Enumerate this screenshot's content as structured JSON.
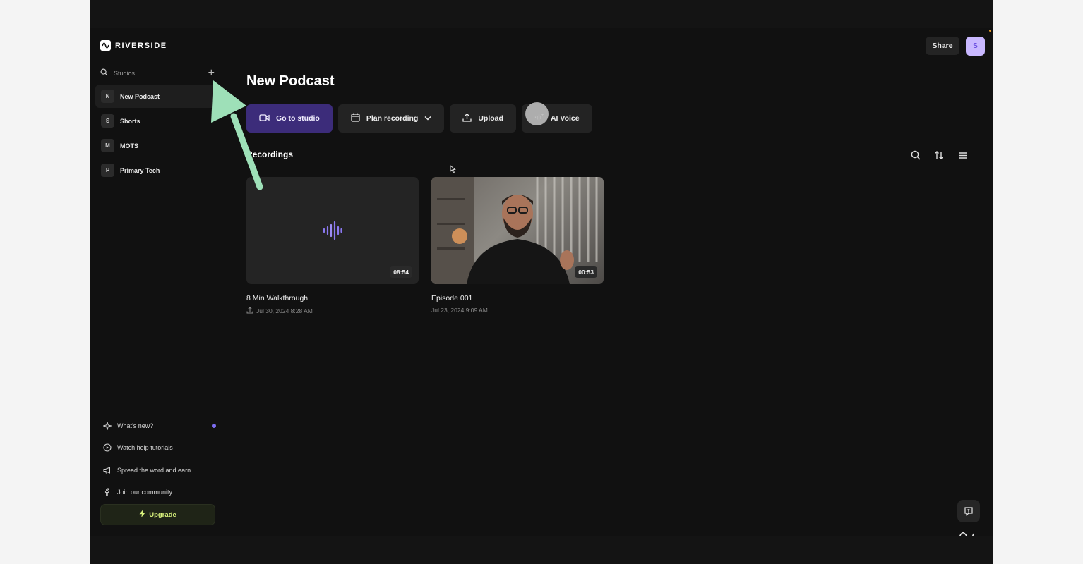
{
  "app": {
    "brand": "RIVERSIDE"
  },
  "sidebar": {
    "studios_label": "Studios",
    "studios": [
      {
        "initial": "N",
        "label": "New Podcast",
        "active": true
      },
      {
        "initial": "S",
        "label": "Shorts",
        "active": false
      },
      {
        "initial": "M",
        "label": "MOTS",
        "active": false
      },
      {
        "initial": "P",
        "label": "Primary Tech",
        "active": false
      }
    ],
    "links": [
      {
        "label": "What's new?",
        "icon": "sparkle-icon"
      },
      {
        "label": "Watch help tutorials",
        "icon": "play-circle-icon"
      },
      {
        "label": "Spread the word and earn",
        "icon": "megaphone-icon"
      },
      {
        "label": "Join our community",
        "icon": "facebook-icon"
      }
    ],
    "upgrade_label": "Upgrade"
  },
  "header": {
    "share_label": "Share",
    "avatar_initial": "S"
  },
  "main": {
    "title": "New Podcast",
    "actions": {
      "go_to_studio": "Go to studio",
      "plan_recording": "Plan recording",
      "upload": "Upload",
      "ai_voice": "AI Voice"
    },
    "recordings_title": "Recordings",
    "recordings": [
      {
        "title": "8 Min Walkthrough",
        "date": "Jul 30, 2024 8:28 AM",
        "duration": "08:54",
        "type": "audio"
      },
      {
        "title": "Episode 001",
        "date": "Jul 23, 2024 9:09 AM",
        "duration": "00:53",
        "type": "video"
      }
    ]
  },
  "colors": {
    "accent": "#3c2c7a",
    "upgrade_text": "#d8f27c",
    "annotation_arrow": "#9ee0b8",
    "avatar_bg": "#c9b8ff"
  }
}
